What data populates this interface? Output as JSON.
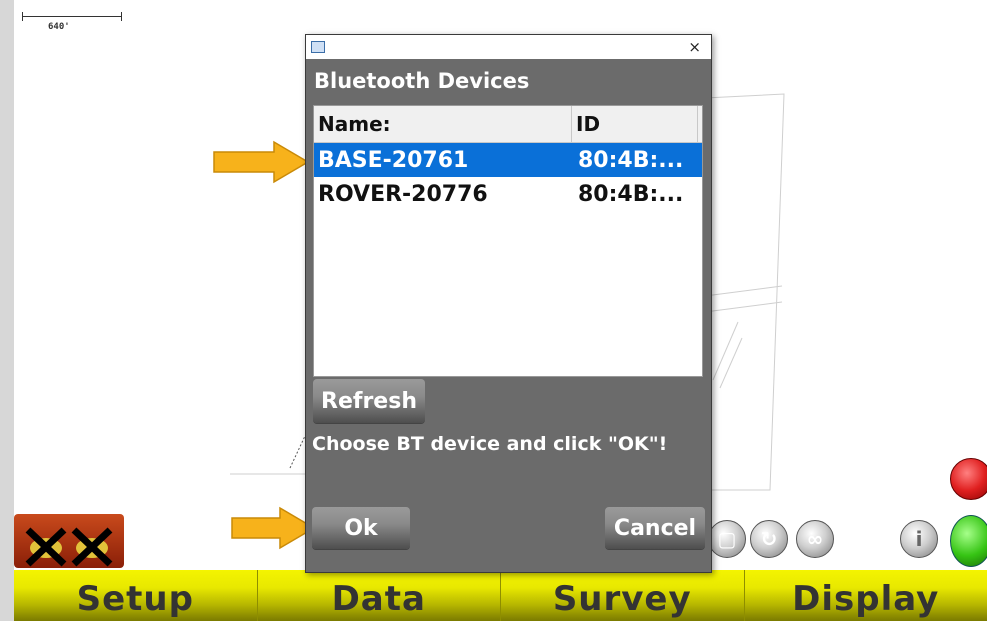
{
  "map": {
    "scale_label": "640'"
  },
  "dialog": {
    "title": "Bluetooth Devices",
    "close_glyph": "×",
    "columns": {
      "name": "Name:",
      "id": "ID"
    },
    "devices": [
      {
        "name": "BASE-20761",
        "id": "80:4B:...",
        "selected": true
      },
      {
        "name": "ROVER-20776",
        "id": "80:4B:...",
        "selected": false
      }
    ],
    "refresh_label": "Refresh",
    "prompt": "Choose BT device and click \"OK\"!",
    "ok_label": "Ok",
    "cancel_label": "Cancel"
  },
  "bottom_nav": [
    {
      "label": "Setup"
    },
    {
      "label": "Data"
    },
    {
      "label": "Survey"
    },
    {
      "label": "Display"
    }
  ],
  "icons": {
    "gps_status": "gps-disconnected-icon",
    "info": "info-icon",
    "pan": "hand-pan-icon",
    "refresh": "rotate-icon",
    "loop": "infinity-icon",
    "remove_point": "delete-point-icon"
  },
  "colors": {
    "nav_yellow": "#e8e800",
    "dialog_gray": "#6b6b6b",
    "selection_blue": "#0a70d8",
    "arrow_orange": "#f7b21b"
  }
}
